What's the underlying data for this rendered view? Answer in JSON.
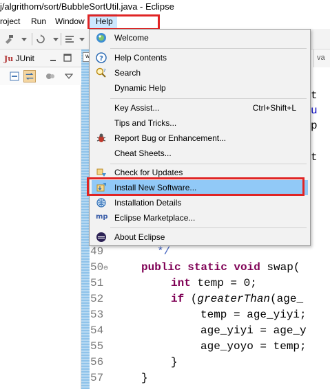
{
  "window": {
    "title": "j/algrithom/sort/BubbleSortUtil.java - Eclipse"
  },
  "menubar": {
    "items": [
      "roject",
      "Run",
      "Window",
      "Help"
    ]
  },
  "junit": {
    "tab_label": "JUnit",
    "tab_icon_text": "Ju"
  },
  "editor": {
    "tab_icon_text": "w",
    "right_tab_text": "va",
    "line_numbers": [
      "49",
      "50",
      "51",
      "52",
      "53",
      "54",
      "55",
      "56",
      "57"
    ],
    "fold_marker": "⊖",
    "peek_chars": [
      "t",
      "u",
      "p",
      "t"
    ],
    "comment_tail": "*/",
    "code": {
      "l50_a": "public static void",
      "l50_b": " swap(",
      "l51_a": "int",
      "l51_b": " temp = 0;",
      "l52_a": "if",
      "l52_b": " (",
      "l52_c": "greaterThan",
      "l52_d": "(age_",
      "l53": "temp = age_yiyi;",
      "l54": "age_yiyi = age_y",
      "l55": "age_yoyo = temp;",
      "l56": "}",
      "l57": "}"
    }
  },
  "help_menu": {
    "items": [
      {
        "label": "Welcome",
        "icon": "welcome-icon"
      },
      {
        "label": "Help Contents",
        "icon": "help-contents-icon"
      },
      {
        "label": "Search",
        "icon": "search-help-icon"
      },
      {
        "label": "Dynamic Help",
        "icon": ""
      },
      {
        "label": "Key Assist...",
        "shortcut": "Ctrl+Shift+L",
        "icon": ""
      },
      {
        "label": "Tips and Tricks...",
        "icon": ""
      },
      {
        "label": "Report Bug or Enhancement...",
        "icon": "report-bug-icon"
      },
      {
        "label": "Cheat Sheets...",
        "icon": ""
      },
      {
        "label": "Check for Updates",
        "icon": "check-updates-icon"
      },
      {
        "label": "Install New Software...",
        "icon": "install-software-icon"
      },
      {
        "label": "Installation Details",
        "icon": "installation-details-icon"
      },
      {
        "label": "Eclipse Marketplace...",
        "icon": "marketplace-icon",
        "icon_text": "mp"
      },
      {
        "label": "About Eclipse",
        "icon": "about-eclipse-icon"
      }
    ]
  },
  "colors": {
    "highlight_red": "#e02424",
    "menu_highlight": "#91c9f7",
    "menubar_selected": "#cce8ff",
    "keyword": "#7f0055",
    "field": "#0000c0"
  }
}
